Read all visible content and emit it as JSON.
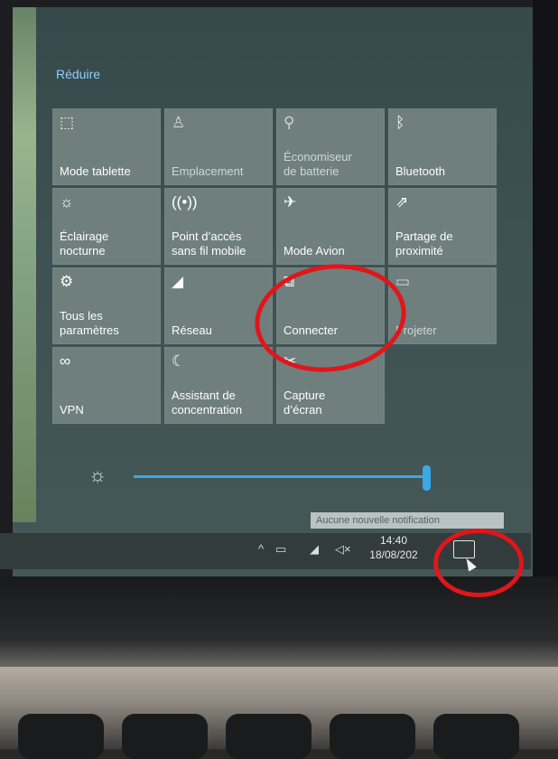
{
  "action_center": {
    "collapse_label": "Réduire",
    "tiles": [
      {
        "label": "Mode tablette",
        "icon": "tablet-mode-icon",
        "glyph": "⬚",
        "state": "on"
      },
      {
        "label": "Emplacement",
        "icon": "location-icon",
        "glyph": "♙",
        "state": "off"
      },
      {
        "label": "Économiseur\nde batterie",
        "icon": "battery-saver-icon",
        "glyph": "⚲",
        "state": "off"
      },
      {
        "label": "Bluetooth",
        "icon": "bluetooth-icon",
        "glyph": "ᛒ",
        "state": "on"
      },
      {
        "label": "Éclairage\nnocturne",
        "icon": "night-light-icon",
        "glyph": "☼",
        "state": "on"
      },
      {
        "label": "Point d’accès\nsans fil mobile",
        "icon": "mobile-hotspot-icon",
        "glyph": "((•))",
        "state": "on"
      },
      {
        "label": "Mode Avion",
        "icon": "airplane-mode-icon",
        "glyph": "✈",
        "state": "on"
      },
      {
        "label": "Partage de\nproximité",
        "icon": "nearby-sharing-icon",
        "glyph": "⇗",
        "state": "on"
      },
      {
        "label": "Tous les\nparamètres",
        "icon": "settings-gear-icon",
        "glyph": "⚙",
        "state": "on"
      },
      {
        "label": "Réseau",
        "icon": "network-icon",
        "glyph": "◢",
        "state": "on"
      },
      {
        "label": "Connecter",
        "icon": "connect-icon",
        "glyph": "⧉",
        "state": "on"
      },
      {
        "label": "Projeter",
        "icon": "project-icon",
        "glyph": "▭",
        "state": "off"
      },
      {
        "label": "VPN",
        "icon": "vpn-icon",
        "glyph": "∞",
        "state": "on"
      },
      {
        "label": "Assistant de\nconcentration",
        "icon": "focus-assist-icon",
        "glyph": "☾",
        "state": "on"
      },
      {
        "label": "Capture\nd’écran",
        "icon": "screen-snip-icon",
        "glyph": "✂",
        "state": "on"
      }
    ],
    "brightness_percent": 100
  },
  "notification_toast": "Aucune nouvelle notification",
  "taskbar": {
    "tray_icons": [
      "chevron-up-icon",
      "battery-icon",
      "wifi-icon",
      "speaker-muted-icon"
    ],
    "tray_glyphs": {
      "chevron": "^",
      "battery": "▭",
      "wifi": "◢",
      "volume": "◁×"
    },
    "time": "14:40",
    "date": "18/08/202"
  },
  "annotation_color": "#e0161b"
}
